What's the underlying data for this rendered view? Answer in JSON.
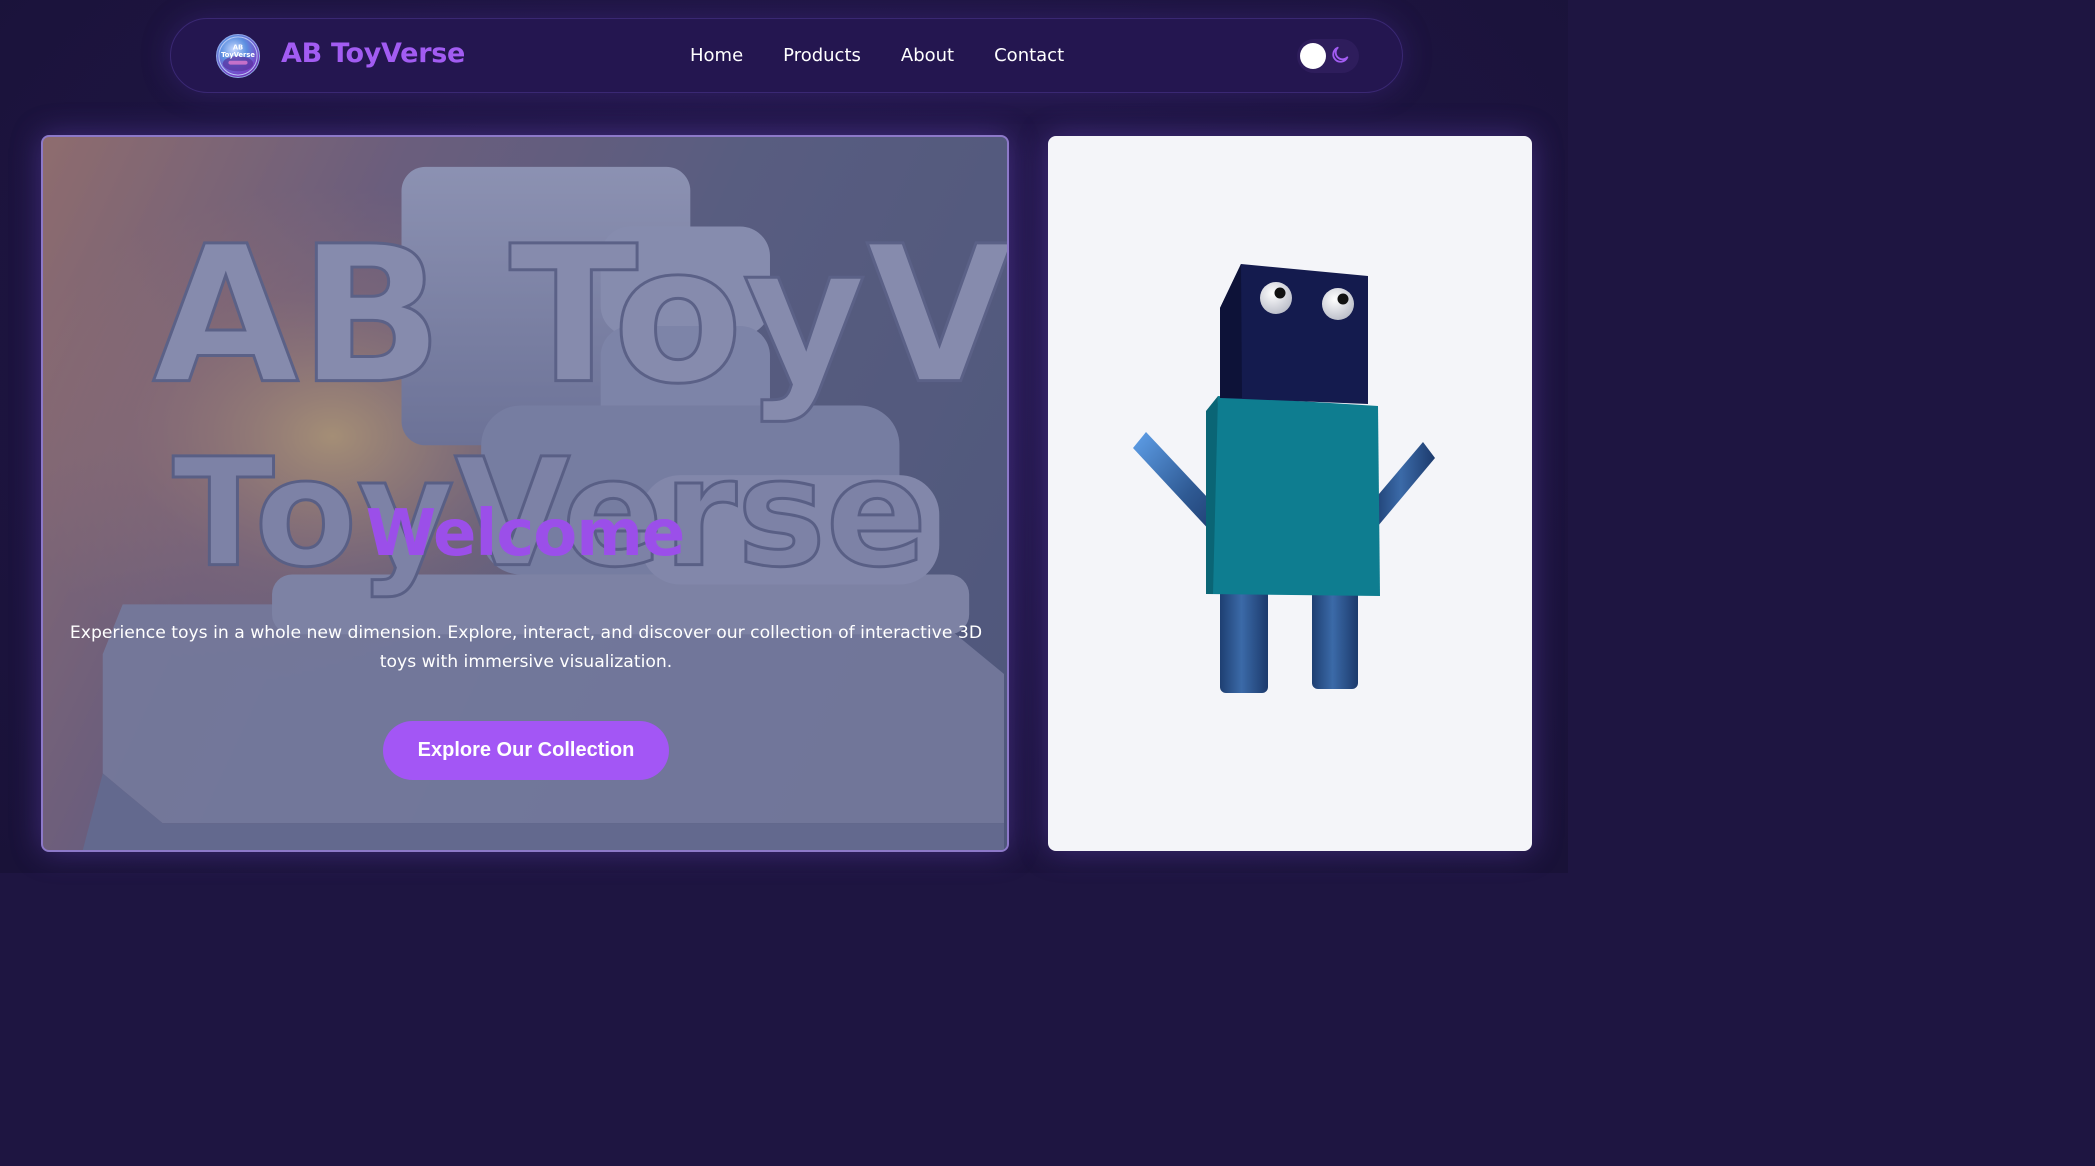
{
  "nav": {
    "brand": "AB ToyVerse",
    "logo_text": "AB ToyVerse",
    "links": [
      "Home",
      "Products",
      "About",
      "Contact"
    ],
    "theme_toggle_icon": "moon-icon"
  },
  "hero": {
    "background_lettering": "AB ToyVerse",
    "title": "Welcome",
    "description": "Experience toys in a whole new dimension. Explore, interact, and discover our collection of interactive 3D toys with immersive visualization.",
    "cta_label": "Explore Our Collection"
  },
  "viewer": {
    "model": "robot-toy",
    "colors": {
      "head": "#141b4e",
      "body": "#0e7d90",
      "limbs": "#2f5a94",
      "background": "#f4f5f9"
    }
  },
  "colors": {
    "accent": "#a356f5",
    "brand": "#a25cf2",
    "page_bg": "#1e1541"
  }
}
